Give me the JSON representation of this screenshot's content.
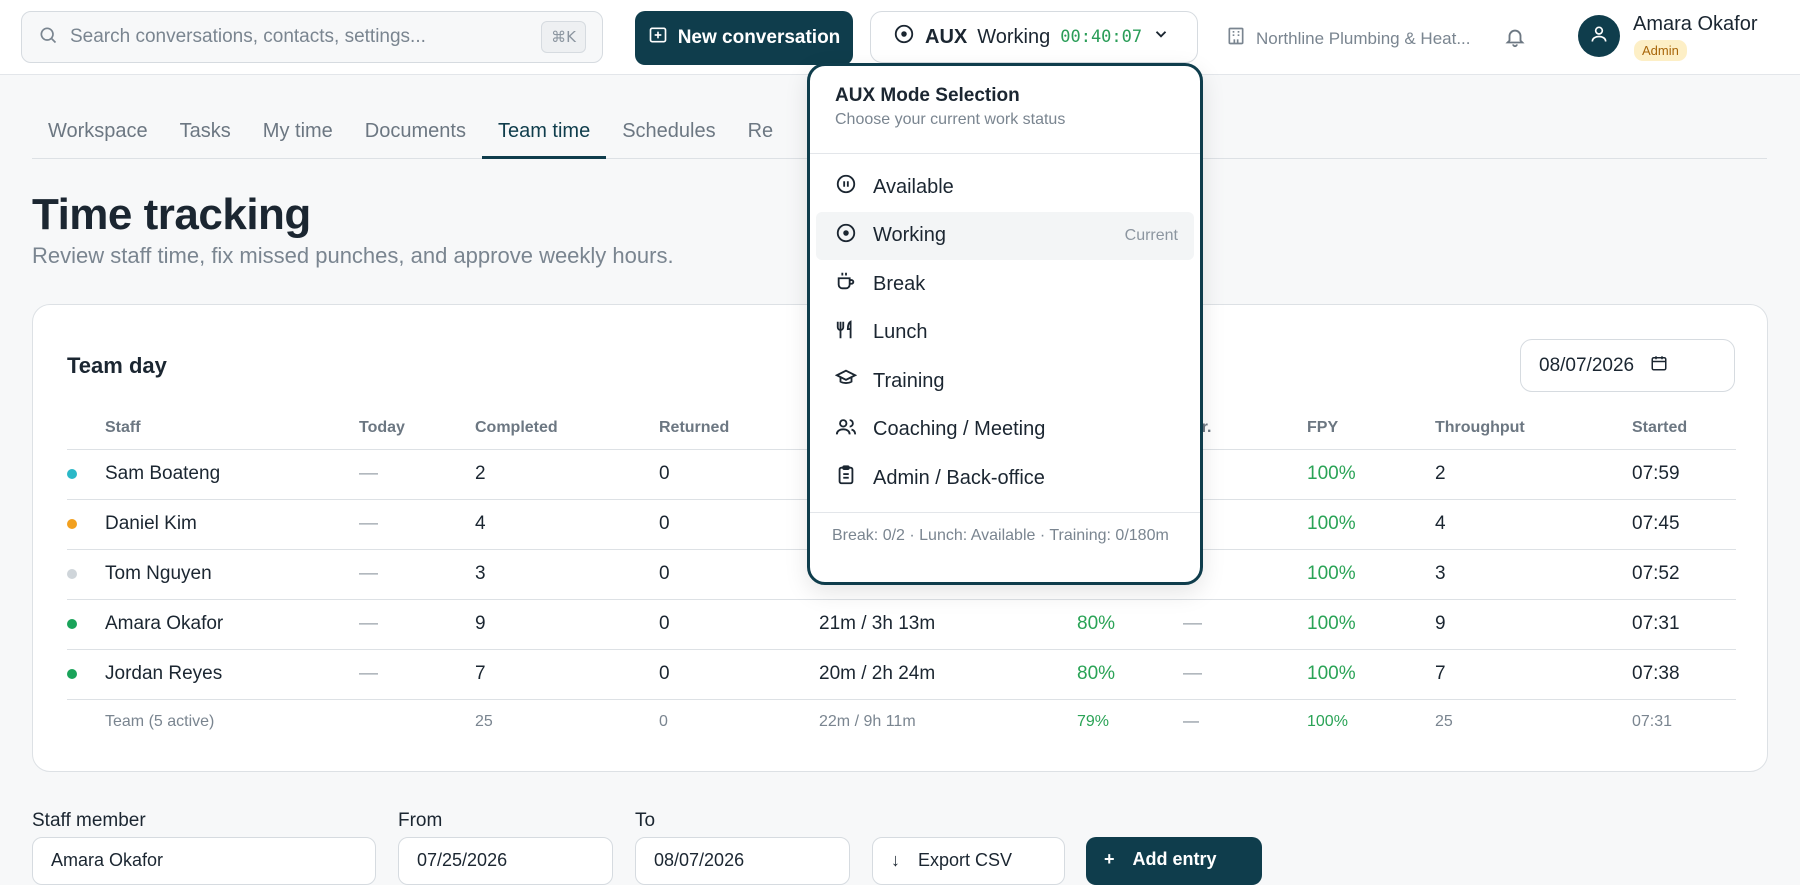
{
  "search": {
    "placeholder": "Search conversations, contacts, settings...",
    "shortcut": "⌘K"
  },
  "header": {
    "new_conversation": "New conversation",
    "aux": {
      "label": "AUX",
      "status": "Working",
      "timer": "00:40:07"
    },
    "org_name": "Northline Plumbing & Heat...",
    "user_name": "Amara Okafor",
    "user_role": "Admin"
  },
  "tabs": [
    "Workspace",
    "Tasks",
    "My time",
    "Documents",
    "Team time",
    "Schedules",
    "Re"
  ],
  "page": {
    "title": "Time tracking",
    "subtitle": "Review staff time, fix missed punches, and approve weekly hours."
  },
  "team_day": {
    "title": "Team day",
    "date": "08/07/2026",
    "columns": [
      "Staff",
      "Today",
      "Completed",
      "Returned",
      "",
      "",
      "her.",
      "FPY",
      "Throughput",
      "Started"
    ],
    "rows": [
      {
        "dot": "#2bb8c7",
        "name": "Sam Boateng",
        "today": "—",
        "completed": "2",
        "returned": "0",
        "time": "",
        "pct": "",
        "other": "",
        "fpy": "100%",
        "throughput": "2",
        "started": "07:59"
      },
      {
        "dot": "#f2a01f",
        "name": "Daniel Kim",
        "today": "—",
        "completed": "4",
        "returned": "0",
        "time": "",
        "pct": "",
        "other": "",
        "fpy": "100%",
        "throughput": "4",
        "started": "07:45"
      },
      {
        "dot": "#cfd5da",
        "name": "Tom Nguyen",
        "today": "—",
        "completed": "3",
        "returned": "0",
        "time": "",
        "pct": "",
        "other": "",
        "fpy": "100%",
        "throughput": "3",
        "started": "07:52"
      },
      {
        "dot": "#1aa35a",
        "name": "Amara Okafor",
        "today": "—",
        "completed": "9",
        "returned": "0",
        "time": "21m / 3h 13m",
        "pct": "80%",
        "other": "—",
        "fpy": "100%",
        "throughput": "9",
        "started": "07:31"
      },
      {
        "dot": "#1aa35a",
        "name": "Jordan Reyes",
        "today": "—",
        "completed": "7",
        "returned": "0",
        "time": "20m / 2h 24m",
        "pct": "80%",
        "other": "—",
        "fpy": "100%",
        "throughput": "7",
        "started": "07:38"
      }
    ],
    "total": {
      "name": "Team (5 active)",
      "completed": "25",
      "returned": "0",
      "time": "22m / 9h 11m",
      "pct": "79%",
      "other": "—",
      "fpy": "100%",
      "throughput": "25",
      "started": "07:31"
    }
  },
  "filters": {
    "staff_label": "Staff member",
    "staff_value": "Amara Okafor",
    "from_label": "From",
    "from_value": "07/25/2026",
    "to_label": "To",
    "to_value": "08/07/2026",
    "export": "Export CSV",
    "add": "Add entry"
  },
  "aux_menu": {
    "title": "AUX Mode Selection",
    "subtitle": "Choose your current work status",
    "items": [
      {
        "label": "Available",
        "icon": "pause-circle-icon"
      },
      {
        "label": "Working",
        "icon": "target-icon",
        "tag": "Current"
      },
      {
        "label": "Break",
        "icon": "coffee-cup-icon"
      },
      {
        "label": "Lunch",
        "icon": "utensils-icon"
      },
      {
        "label": "Training",
        "icon": "graduation-cap-icon"
      },
      {
        "label": "Coaching / Meeting",
        "icon": "users-icon"
      },
      {
        "label": "Admin / Back-office",
        "icon": "clipboard-icon"
      }
    ],
    "footer": "Break: 0/2 · Lunch: Available · Training: 0/180m"
  },
  "colors": {
    "primary": "#0f3d4c",
    "success": "#2aa356",
    "timer": "#2a9d58",
    "badge_bg": "#fdefc6",
    "badge_text": "#a8660b"
  }
}
